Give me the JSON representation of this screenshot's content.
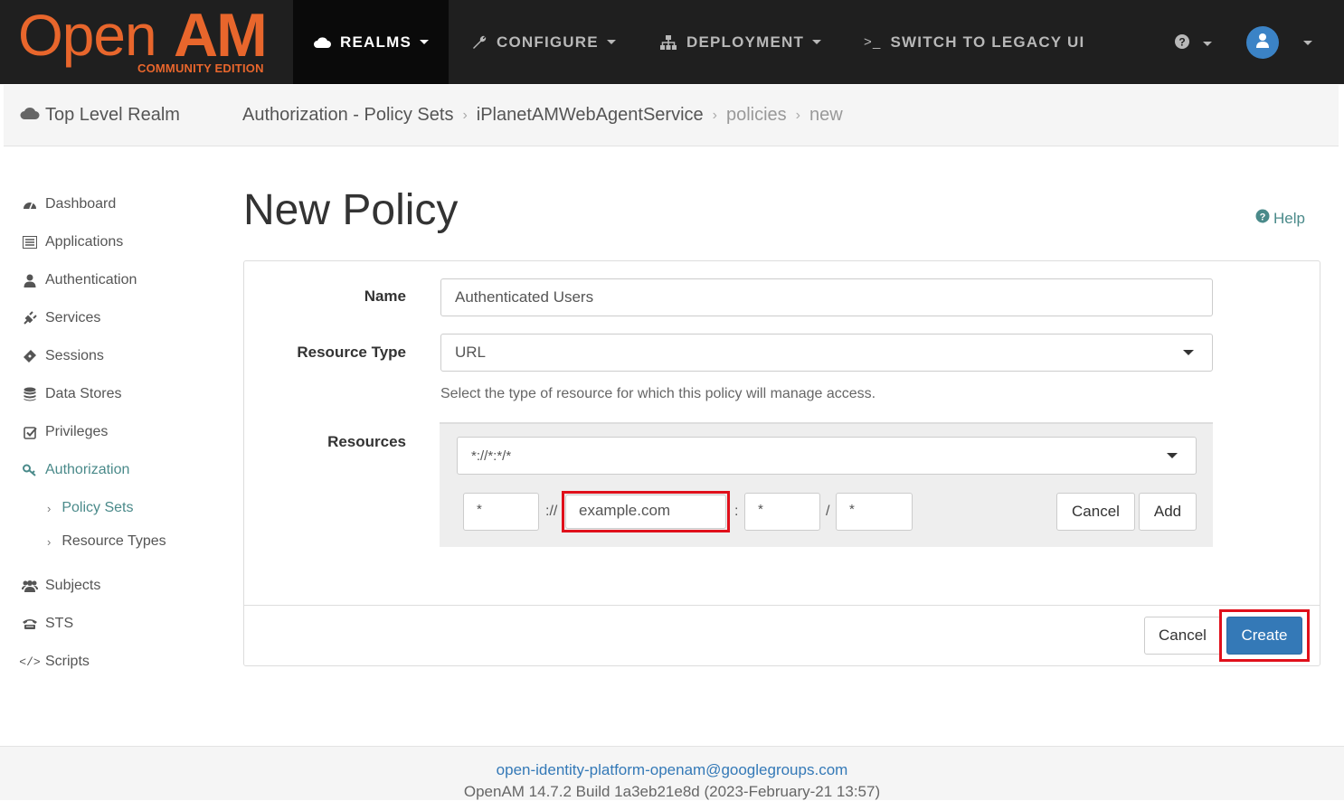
{
  "brand": {
    "open": "Open",
    "am": "AM",
    "edition": "COMMUNITY EDITION"
  },
  "nav": {
    "realms": "REALMS",
    "configure": "CONFIGURE",
    "deployment": "DEPLOYMENT",
    "legacy": "SWITCH TO LEGACY UI"
  },
  "breadcrumb": {
    "realm": "Top Level Realm",
    "items": [
      "Authorization - Policy Sets",
      "iPlanetAMWebAgentService",
      "policies",
      "new"
    ]
  },
  "sidebar": {
    "items": [
      "Dashboard",
      "Applications",
      "Authentication",
      "Services",
      "Sessions",
      "Data Stores",
      "Privileges",
      "Authorization"
    ],
    "sub": [
      "Policy Sets",
      "Resource Types"
    ],
    "after": [
      "Subjects",
      "STS",
      "Scripts"
    ]
  },
  "page": {
    "title": "New Policy",
    "help": "Help"
  },
  "form": {
    "name_label": "Name",
    "name_value": "Authenticated Users",
    "type_label": "Resource Type",
    "type_value": "URL",
    "type_hint": "Select the type of resource for which this policy will manage access.",
    "resources_label": "Resources",
    "pattern_value": "*://*:*/*",
    "scheme": "*",
    "sep_scheme": "://",
    "host": "example.com",
    "sep_port": ":",
    "port": "*",
    "sep_path": "/",
    "path": "*",
    "cancel_small": "Cancel",
    "add": "Add",
    "cancel": "Cancel",
    "create": "Create"
  },
  "footer": {
    "email": "open-identity-platform-openam@googlegroups.com",
    "build": "OpenAM 14.7.2 Build 1a3eb21e8d (2023-February-21 13:57)"
  },
  "colors": {
    "brand": "#e8662c",
    "navbar": "#1f1f1f",
    "primary": "#3479b7",
    "active": "#4a8a8a",
    "highlight": "#e0101b"
  }
}
